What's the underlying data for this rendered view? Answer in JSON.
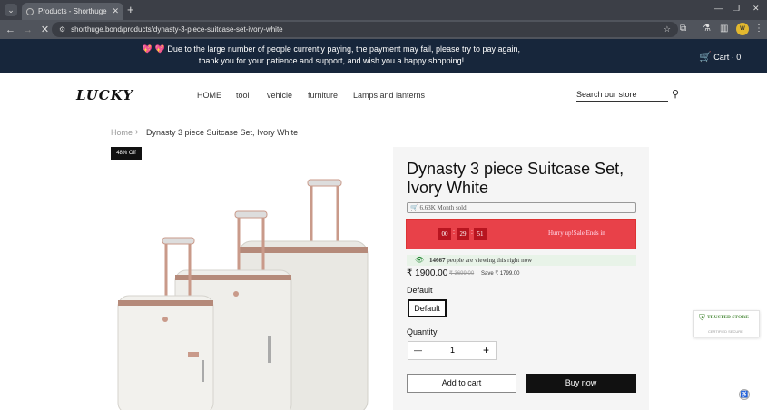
{
  "browser": {
    "tab_title": "Products - Shorthuge",
    "url": "shorthuge.bond/products/dynasty-3-piece-suitcase-set-ivory-white",
    "avatar_initials": "W"
  },
  "announcement": {
    "text": "💖 💖 Due to the large number of people currently paying, the payment may fail, please try to pay again, thank you for your patience and support, and wish you a happy shopping!",
    "cart_label": "Cart · 0"
  },
  "header": {
    "logo": "LUCKY",
    "nav": [
      "HOME",
      "tool",
      "vehicle",
      "furniture",
      "Lamps and lanterns"
    ],
    "search_placeholder": "Search our store"
  },
  "breadcrumb": {
    "home": "Home",
    "current": "Dynasty 3 piece Suitcase Set, Ivory White"
  },
  "product": {
    "badge": "48% Off",
    "title": "Dynasty 3 piece Suitcase Set, Ivory White",
    "sold": "6.63K  Month sold",
    "timer": {
      "h": "00",
      "m": "29",
      "s": "51",
      "note": "Hurry up!Sale Ends in"
    },
    "viewing_count": "14667",
    "viewing_text": "people are viewing this right now",
    "price": "₹ 1900.00",
    "compare_price": "₹ 3699.00",
    "save": "Save ₹ 1799.00",
    "option_label": "Default",
    "option_value": "Default",
    "qty_label": "Quantity",
    "qty": "1",
    "add_to_cart": "Add to cart",
    "buy_now": "Buy now"
  },
  "trust": {
    "title": "TRUSTED STORE",
    "sub": "CERTIFIED SECURE"
  }
}
